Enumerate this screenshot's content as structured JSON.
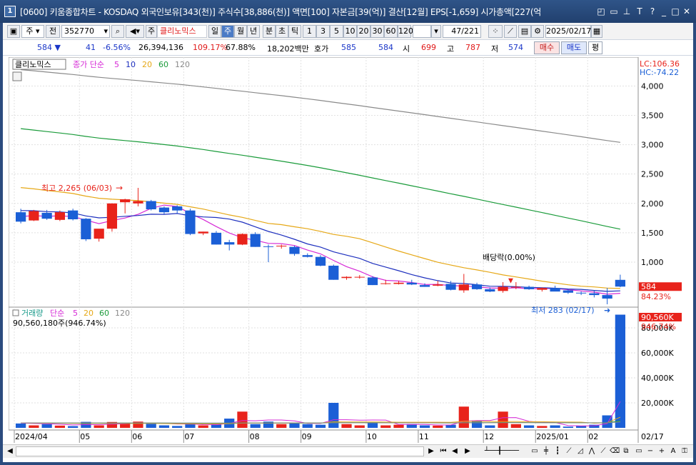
{
  "window": {
    "number": "1",
    "title": "[0600] 키움종합차트 - KOSDAQ 외국인보유[343(천)] 주식수[38,886(천)] 액면[100] 자본금[39(억)] 결산[12월] EPS[-1,659] 시가총액[227(억"
  },
  "toolbar": {
    "type_label": "주",
    "prev_label": "전",
    "code": "352770",
    "name": "클리노믹스",
    "periods": [
      "일",
      "주",
      "월",
      "년"
    ],
    "selected_period": "주",
    "units": [
      "분",
      "초",
      "틱"
    ],
    "intervals": [
      "1",
      "3",
      "5",
      "10",
      "20",
      "30",
      "60",
      "120"
    ],
    "count": "47/221",
    "date": "2025/02/17"
  },
  "quote": {
    "price": "584",
    "change": "41",
    "change_pct": "-6.56%",
    "volume": "26,394,136",
    "volume_ratio": "109.17%",
    "turnover": "67.88%",
    "amount": "18,202백만",
    "bid_label": "호가",
    "ask": "585",
    "bid": "584",
    "open_label": "시",
    "open": "699",
    "high_label": "고",
    "high": "787",
    "low_label": "저",
    "low": "574",
    "buy_label": "매수",
    "sell_label": "매도",
    "flat_label": "평"
  },
  "price_panel": {
    "stock_name": "클리노믹스",
    "ma_label": "종가 단순",
    "ma_periods": [
      "5",
      "10",
      "20",
      "60",
      "120"
    ],
    "ma_colors": [
      "#d62bd6",
      "#1d2fbe",
      "#e6a817",
      "#1a9b3a",
      "#8a8a8a"
    ],
    "lc_label": "LC:106.36",
    "hc_label": "HC:-74.22",
    "price_tag": "584",
    "pct_tag": "84.23%",
    "high_note": "최고 2,265 (06/03)",
    "low_note": "최저 283 (02/17)",
    "dividend_note": "배당락(0.00%)",
    "y_ticks": [
      "4,000",
      "3,500",
      "3,000",
      "2,500",
      "2,000",
      "1,500",
      "1,000"
    ]
  },
  "volume_panel": {
    "title": "거래량",
    "ma_label": "단순",
    "ma_periods": [
      "5",
      "20",
      "60",
      "120"
    ],
    "ma_colors": [
      "#d62bd6",
      "#e6a817",
      "#1a9b3a",
      "#8a8a8a"
    ],
    "info": "90,560,180주(946.74%)",
    "vol_tag": "90,560K",
    "pct_tag": "946.74%",
    "y_ticks": [
      "80,000K",
      "60,000K",
      "40,000K",
      "20,000K"
    ]
  },
  "x_axis": {
    "labels": [
      "2024/04",
      "05",
      "06",
      "07",
      "08",
      "09",
      "10",
      "11",
      "12",
      "2025/01",
      "02"
    ],
    "right_label": "02/17"
  },
  "chart_data": {
    "type": "candlestick",
    "x": [
      "2024/04/01",
      "04/08",
      "04/15",
      "04/22",
      "04/29",
      "05/06",
      "05/13",
      "05/20",
      "05/27",
      "06/03",
      "06/10",
      "06/17",
      "06/24",
      "07/01",
      "07/08",
      "07/15",
      "07/22",
      "07/29",
      "08/05",
      "08/12",
      "08/19",
      "08/26",
      "09/02",
      "09/09",
      "09/16",
      "09/23",
      "09/30",
      "10/07",
      "10/14",
      "10/21",
      "10/28",
      "11/04",
      "11/11",
      "11/18",
      "11/25",
      "12/02",
      "12/09",
      "12/16",
      "12/23",
      "12/30",
      "2025/01/06",
      "01/13",
      "01/20",
      "01/27",
      "02/03",
      "02/10",
      "02/17"
    ],
    "ohlc": [
      [
        1850,
        1910,
        1660,
        1690
      ],
      [
        1710,
        1890,
        1700,
        1870
      ],
      [
        1840,
        1890,
        1720,
        1740
      ],
      [
        1720,
        1880,
        1700,
        1850
      ],
      [
        1880,
        1910,
        1710,
        1730
      ],
      [
        1740,
        1750,
        1360,
        1390
      ],
      [
        1400,
        1560,
        1350,
        1570
      ],
      [
        1570,
        2000,
        1520,
        2000
      ],
      [
        2020,
        2080,
        1830,
        2070
      ],
      [
        2000,
        2265,
        1950,
        2040
      ],
      [
        2040,
        2060,
        1880,
        1900
      ],
      [
        1930,
        1950,
        1820,
        1850
      ],
      [
        1950,
        1970,
        1830,
        1880
      ],
      [
        1880,
        1910,
        1460,
        1480
      ],
      [
        1490,
        1520,
        1460,
        1520
      ],
      [
        1500,
        1530,
        1300,
        1300
      ],
      [
        1340,
        1380,
        1200,
        1300
      ],
      [
        1300,
        1490,
        1290,
        1480
      ],
      [
        1480,
        1510,
        1260,
        1260
      ],
      [
        1270,
        1300,
        1000,
        1260
      ],
      [
        1280,
        1300,
        1230,
        1280
      ],
      [
        1260,
        1280,
        1110,
        1140
      ],
      [
        1120,
        1150,
        1080,
        1090
      ],
      [
        1090,
        1120,
        930,
        940
      ],
      [
        940,
        960,
        700,
        700
      ],
      [
        730,
        760,
        700,
        750
      ],
      [
        740,
        780,
        720,
        750
      ],
      [
        740,
        760,
        610,
        610
      ],
      [
        640,
        700,
        620,
        640
      ],
      [
        630,
        680,
        620,
        650
      ],
      [
        650,
        700,
        610,
        620
      ],
      [
        610,
        640,
        580,
        580
      ],
      [
        600,
        680,
        590,
        620
      ],
      [
        630,
        680,
        520,
        530
      ],
      [
        520,
        800,
        480,
        620
      ],
      [
        620,
        650,
        530,
        540
      ],
      [
        540,
        570,
        490,
        500
      ],
      [
        510,
        660,
        480,
        580
      ],
      [
        570,
        660,
        540,
        580
      ],
      [
        580,
        600,
        530,
        540
      ],
      [
        530,
        570,
        500,
        560
      ],
      [
        560,
        600,
        510,
        500
      ],
      [
        520,
        540,
        460,
        480
      ],
      [
        480,
        500,
        440,
        470
      ],
      [
        470,
        520,
        400,
        440
      ],
      [
        440,
        560,
        283,
        380
      ],
      [
        699,
        787,
        574,
        584
      ]
    ],
    "volume_k": [
      3500,
      2000,
      3000,
      1800,
      1400,
      4800,
      2000,
      4700,
      3500,
      5000,
      3300,
      2000,
      1500,
      4000,
      2000,
      3000,
      7400,
      13000,
      3000,
      5000,
      3000,
      4000,
      3000,
      2500,
      20000,
      3000,
      2000,
      4000,
      2000,
      2500,
      3000,
      2000,
      1800,
      2500,
      17000,
      6000,
      2000,
      13000,
      3000,
      2000,
      1500,
      2000,
      1000,
      1500,
      2500,
      10000,
      90560
    ],
    "ylim_price": [
      283,
      4150
    ],
    "ylim_volume": [
      0,
      92000
    ]
  }
}
